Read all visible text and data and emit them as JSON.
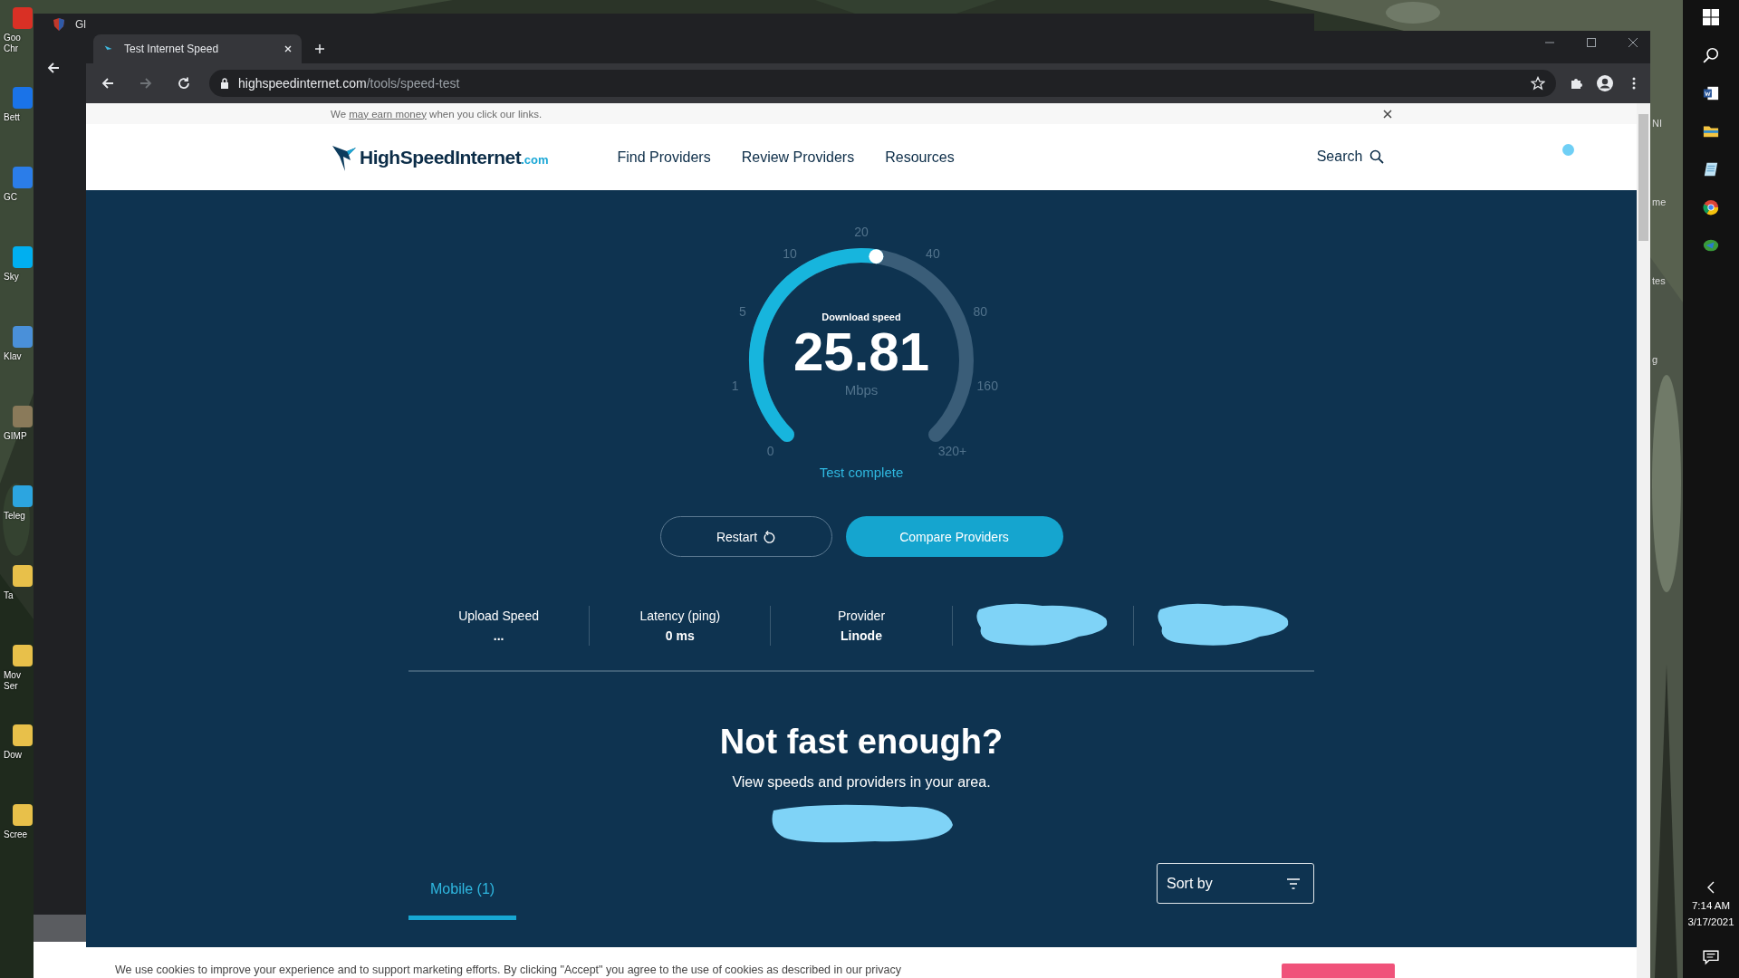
{
  "desktop": {
    "icons": [
      {
        "lines": [
          "Goo",
          "Chr"
        ],
        "color": "#d93025"
      },
      {
        "lines": [
          "Bett"
        ],
        "color": "#1a73e8"
      },
      {
        "lines": [
          "GC"
        ],
        "color": "#2b7de9"
      },
      {
        "lines": [
          "Sky"
        ],
        "color": "#00aff0"
      },
      {
        "lines": [
          "Klav"
        ],
        "color": "#4a90d9"
      },
      {
        "lines": [
          "GIMP"
        ],
        "color": "#8a7a5a"
      },
      {
        "lines": [
          "Teleg"
        ],
        "color": "#2ca5e0"
      },
      {
        "lines": [
          "Ta"
        ],
        "color": "#e8c04a"
      },
      {
        "lines": [
          "Mov",
          "Ser"
        ],
        "color": "#e8c04a"
      },
      {
        "lines": [
          "Dow"
        ],
        "color": "#e8c04a"
      },
      {
        "lines": [
          "Scree"
        ],
        "color": "#e8c04a"
      }
    ],
    "fragments": [
      "NI",
      "me",
      "tes",
      "g"
    ]
  },
  "background_window": {
    "tab_title": "Gl"
  },
  "browser": {
    "tab_title": "Test Internet Speed",
    "url_domain": "highspeedinternet.com",
    "url_path": "/tools/speed-test"
  },
  "affiliate_notice": {
    "before": "We ",
    "link": "may earn money",
    "after": " when you click our links."
  },
  "header": {
    "logo_name": "HighSpeedInternet",
    "logo_suffix": ".com",
    "nav": [
      "Find Providers",
      "Review Providers",
      "Resources"
    ],
    "search": "Search"
  },
  "gauge": {
    "label": "Download speed",
    "value": "25.81",
    "unit": "Mbps",
    "status": "Test complete",
    "level": 0.53,
    "ticks": [
      "0",
      "1",
      "5",
      "10",
      "20",
      "40",
      "80",
      "160",
      "320+"
    ]
  },
  "buttons": [
    {
      "label": "Restart",
      "kind": "outline"
    },
    {
      "label": "Compare Providers",
      "kind": "filled"
    }
  ],
  "stats": [
    {
      "kind": "stat",
      "label": "Upload Speed",
      "value": "..."
    },
    {
      "kind": "stat",
      "label": "Latency (ping)",
      "value": "0 ms"
    },
    {
      "kind": "stat",
      "label": "Provider",
      "value": "Linode"
    },
    {
      "kind": "redacted"
    },
    {
      "kind": "redacted"
    }
  ],
  "cta": {
    "title": "Not fast enough?",
    "subtitle": "View speeds and providers in your area.",
    "location": {
      "kind": "redacted"
    }
  },
  "results": {
    "tabs": [
      {
        "label": "Mobile (1)",
        "selected": true
      }
    ],
    "sort": "Sort by"
  },
  "cookie_banner": {
    "text": "We use cookies to improve your experience and to support marketing efforts. By clicking \"Accept\" you agree to the use of cookies as described in our privacy"
  },
  "taskbar": {
    "time": "7:14 AM",
    "date": "3/17/2021"
  }
}
